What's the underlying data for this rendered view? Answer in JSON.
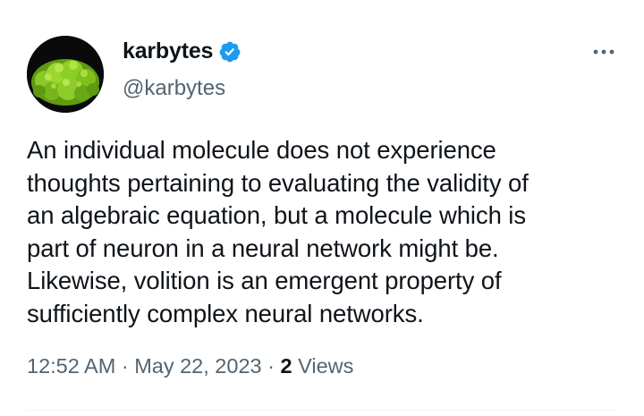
{
  "author": {
    "display_name": "karbytes",
    "handle": "@karbytes",
    "verified": true,
    "avatar_icon": "broccoli-romanesco-avatar",
    "verified_color": "#1d9bf0"
  },
  "tweet": {
    "lines": [
      "An individual molecule does not experience",
      "thoughts pertaining to evaluating the validity of",
      "an algebraic equation, but a molecule which is",
      "part of neuron in a neural network might be.",
      "Likewise, volition is an emergent property of",
      "sufficiently complex neural networks."
    ]
  },
  "meta": {
    "time": "12:52 AM",
    "separator1": "·",
    "date": "May 22, 2023",
    "separator2": "·",
    "views_count": "2",
    "views_label": "Views"
  },
  "icons": {
    "more": "more-options-icon"
  }
}
